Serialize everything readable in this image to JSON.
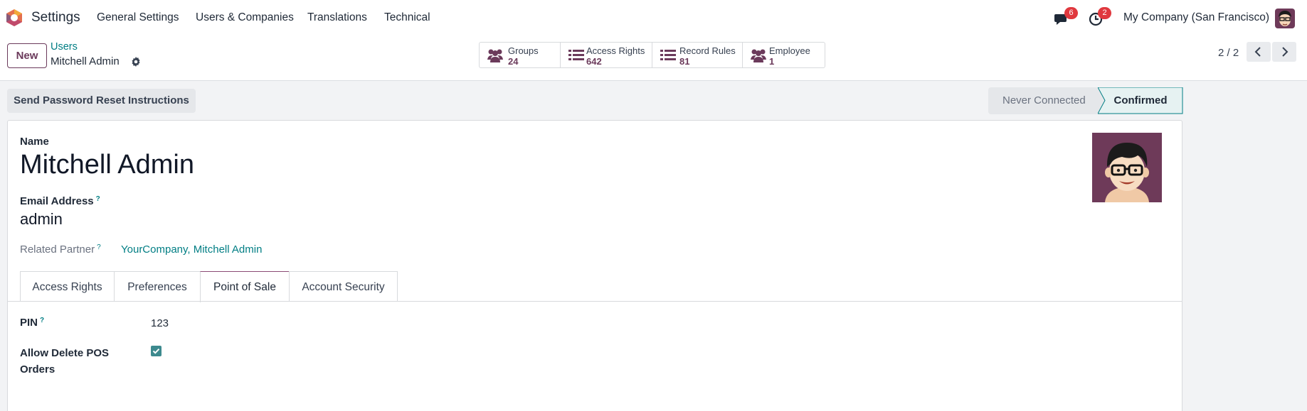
{
  "navbar": {
    "app_name": "Settings",
    "menu": [
      "General Settings",
      "Users & Companies",
      "Translations",
      "Technical"
    ],
    "messages_count": "6",
    "activities_count": "2",
    "company": "My Company (San Francisco)"
  },
  "control": {
    "new_label": "New",
    "breadcrumb_parent": "Users",
    "breadcrumb_current": "Mitchell Admin",
    "stats": [
      {
        "label": "Groups",
        "value": "24",
        "icon": "users-icon"
      },
      {
        "label": "Access Rights",
        "value": "642",
        "icon": "list-icon"
      },
      {
        "label": "Record Rules",
        "value": "81",
        "icon": "list-icon"
      },
      {
        "label": "Employee",
        "value": "1",
        "icon": "users-icon"
      }
    ],
    "pager": "2 / 2"
  },
  "actions": {
    "reset_label": "Send Password Reset Instructions",
    "status_never": "Never Connected",
    "status_confirmed": "Confirmed"
  },
  "form": {
    "name_label": "Name",
    "name_value": "Mitchell Admin",
    "email_label": "Email Address",
    "email_value": "admin",
    "related_label": "Related Partner",
    "related_value": "YourCompany, Mitchell Admin",
    "help_mark": "?",
    "tabs": [
      "Access Rights",
      "Preferences",
      "Point of Sale",
      "Account Security"
    ],
    "active_tab": "Point of Sale",
    "pin_label": "PIN",
    "pin_value": "123",
    "allow_delete_label": "Allow Delete POS Orders",
    "allow_delete_checked": true
  },
  "colors": {
    "brand": "#6b3a5b",
    "link": "#017e84",
    "badge": "#e0383e",
    "checkbox": "#3d8a8e"
  }
}
